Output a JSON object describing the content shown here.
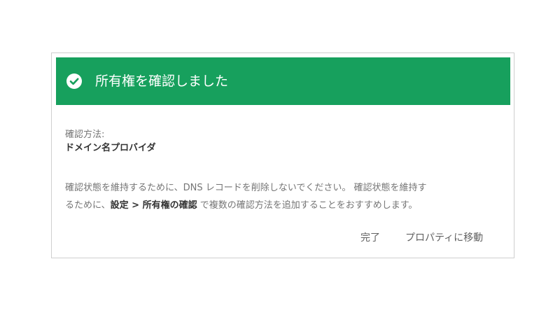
{
  "dialog": {
    "title": "所有権を確認しました",
    "method_label": "確認方法:",
    "method_value": "ドメイン名プロバイダ",
    "message": {
      "line1": "確認状態を維持するために、DNS レコードを削除しないでください。 確認状態を維持す",
      "line2_before": "るために、",
      "line2_bold": "設定 > 所有権の確認",
      "line2_after": " で複数の確認方法を追加することをおすすめします。"
    },
    "buttons": {
      "done": "完了",
      "go_to_property": "プロパティに移動"
    },
    "colors": {
      "header": "#17a05d",
      "header_text": "#ffffff"
    },
    "icons": {
      "header": "check-circle-icon"
    }
  }
}
